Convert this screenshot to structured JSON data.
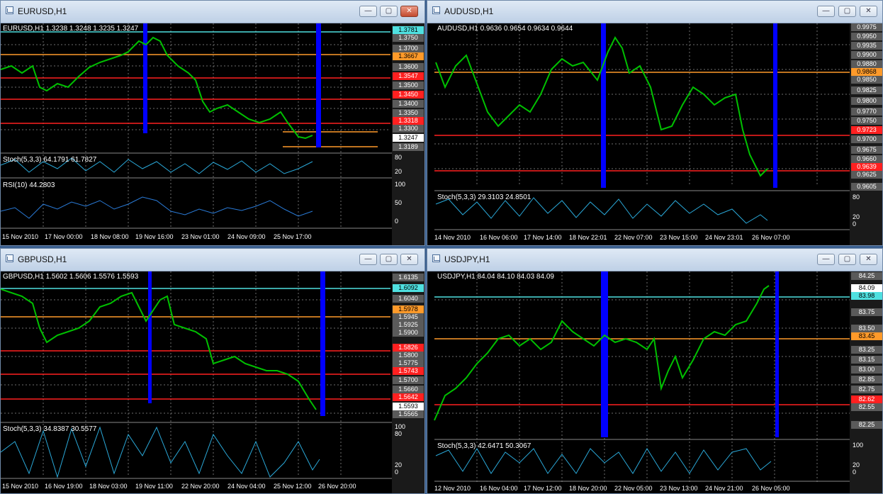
{
  "charts": [
    {
      "title": "EURUSD,H1",
      "header": "EURUSD,H1  1.3238 1.3248 1.3235 1.3247",
      "colors": {
        "up": "#00c000",
        "grid": "#6e6e6e"
      },
      "price_labels": [
        "1.3781",
        "1.3750",
        "1.3700",
        "1.3667",
        "1.3600",
        "1.3547",
        "1.3500",
        "1.3450",
        "1.3400",
        "1.3350",
        "1.3318",
        "1.3300",
        "1.3247",
        "1.3189"
      ],
      "subwindows": [
        {
          "label": "Stoch(5,3,3) 64.1791 61.7827",
          "scale": [
            "80",
            "20"
          ]
        },
        {
          "label": "RSI(10) 44.2803",
          "scale": [
            "100",
            "50",
            "0"
          ]
        }
      ],
      "time_labels": [
        "15 Nov 2010",
        "17 Nov 00:00",
        "18 Nov 08:00",
        "19 Nov 16:00",
        "23 Nov 01:00",
        "24 Nov 09:00",
        "25 Nov 17:00"
      ]
    },
    {
      "title": "AUDUSD,H1",
      "header": "AUDUSD,H1  0.9636 0.9654 0.9634 0.9644",
      "colors": {
        "up": "#00c000",
        "grid": "#6e6e6e"
      },
      "price_labels": [
        "0.9975",
        "0.9950",
        "0.9935",
        "0.9900",
        "0.9880",
        "0.9868",
        "0.9850",
        "0.9825",
        "0.9800",
        "0.9770",
        "0.9750",
        "0.9723",
        "0.9700",
        "0.9675",
        "0.9660",
        "0.9639",
        "0.9625",
        "0.9605"
      ],
      "subwindows": [
        {
          "label": "Stoch(5,3,3) 29.3103 24.8501",
          "scale": [
            "80",
            "20",
            "0"
          ]
        }
      ],
      "time_labels": [
        "14 Nov 2010",
        "16 Nov 06:00",
        "17 Nov 14:00",
        "18 Nov 22:01",
        "22 Nov 07:00",
        "23 Nov 15:00",
        "24 Nov 23:01",
        "26 Nov 07:00"
      ]
    },
    {
      "title": "GBPUSD,H1",
      "header": "GBPUSD,H1  1.5602 1.5606 1.5576 1.5593",
      "colors": {
        "up": "#00c000",
        "grid": "#6e6e6e"
      },
      "price_labels": [
        "1.6135",
        "1.6092",
        "1.6040",
        "1.5978",
        "1.5945",
        "1.5925",
        "1.5900",
        "1.5826",
        "1.5800",
        "1.5775",
        "1.5743",
        "1.5700",
        "1.5660",
        "1.5642",
        "1.5593",
        "1.5565"
      ],
      "subwindows": [
        {
          "label": "Stoch(5,3,3) 34.8387 30.5577",
          "scale": [
            "100",
            "80",
            "20",
            "0"
          ]
        }
      ],
      "time_labels": [
        "15 Nov 2010",
        "16 Nov 19:00",
        "18 Nov 03:00",
        "19 Nov 11:00",
        "22 Nov 20:00",
        "24 Nov 04:00",
        "25 Nov 12:00",
        "26 Nov 20:00"
      ]
    },
    {
      "title": "USDJPY,H1",
      "header": "USDJPY,H1  84.04 84.10 84.03 84.09",
      "colors": {
        "up": "#00c000",
        "grid": "#6e6e6e"
      },
      "price_labels": [
        "84.25",
        "84.09",
        "83.98",
        "83.75",
        "83.50",
        "83.45",
        "83.25",
        "83.15",
        "83.00",
        "82.85",
        "82.75",
        "82.62",
        "82.55",
        "82.25"
      ],
      "subwindows": [
        {
          "label": "Stoch(5,3,3) 42.6471 50.3067",
          "scale": [
            "100",
            "20",
            "0"
          ]
        }
      ],
      "time_labels": [
        "12 Nov 2010",
        "16 Nov 04:00",
        "17 Nov 12:00",
        "18 Nov 20:00",
        "22 Nov 05:00",
        "23 Nov 13:00",
        "24 Nov 21:00",
        "26 Nov 05:00"
      ]
    }
  ]
}
